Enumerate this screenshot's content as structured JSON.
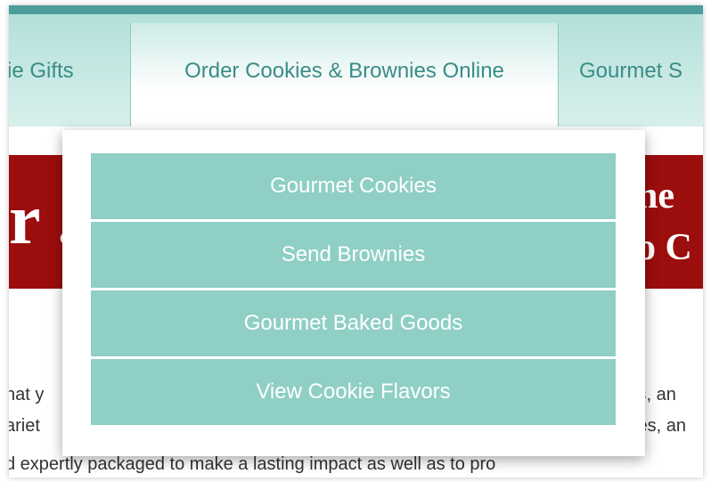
{
  "nav": {
    "tab_gifts": "kie Gifts",
    "tab_order": "Order Cookies & Brownies Online",
    "tab_gourmet": "Gourmet S"
  },
  "banner": {
    "left_text": "r  .",
    "right_line1": "he",
    "right_line2": "o C"
  },
  "dropdown": {
    "items": [
      {
        "label": "Gourmet Cookies"
      },
      {
        "label": "Send Brownies"
      },
      {
        "label": "Gourmet Baked Goods"
      },
      {
        "label": "View Cookie Flavors"
      }
    ]
  },
  "body_text": {
    "line1_left": "hat y",
    "line1_link": "ts",
    "line1_right": ", an",
    "line2_left": "ariet",
    "line2_right": "tes, an",
    "line3": "d expertly packaged to make a lasting impact as well as to pro"
  },
  "colors": {
    "accent": "#8fcfc5",
    "nav_text": "#3a8c88",
    "banner": "#9c0d0d",
    "top_line": "#4b9c9a"
  }
}
